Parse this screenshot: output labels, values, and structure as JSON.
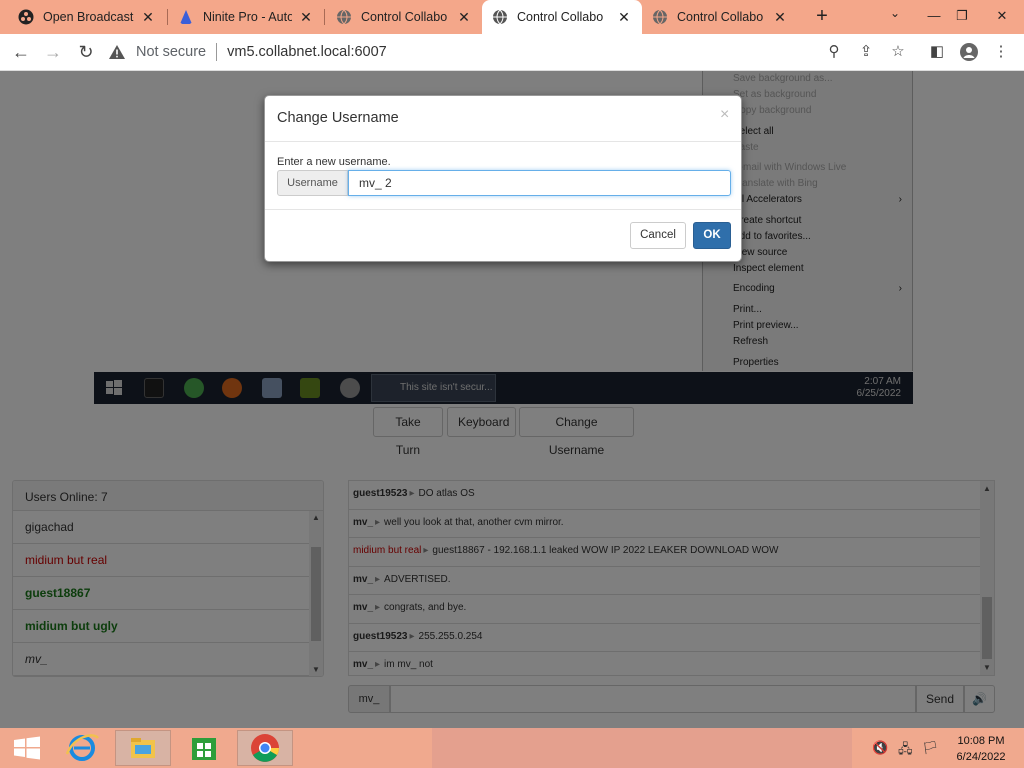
{
  "browser": {
    "tabs": [
      {
        "title": "Open Broadcaste",
        "icon": "obs-icon",
        "active": false
      },
      {
        "title": "Ninite Pro - Auto",
        "icon": "ninite-icon",
        "active": false
      },
      {
        "title": "Control Collabo",
        "icon": "globe-icon",
        "active": false
      },
      {
        "title": "Control Collabo",
        "icon": "globe-icon",
        "active": true
      },
      {
        "title": "Control Collabo",
        "icon": "globe-icon",
        "active": false
      }
    ],
    "security_label": "Not secure",
    "url": "vm5.collabnet.local:6007",
    "tabstrip_color": "#f4a78a"
  },
  "vm": {
    "context_menu": [
      {
        "label": "Save background as...",
        "dim": true
      },
      {
        "label": "Set as background",
        "dim": true
      },
      {
        "label": "Copy background",
        "dim": true
      },
      {
        "label": "Select all",
        "dim": false
      },
      {
        "label": "Paste",
        "dim": true
      },
      {
        "label": "E-mail with Windows Live",
        "dim": true
      },
      {
        "label": "Translate with Bing",
        "dim": true
      },
      {
        "label": "All Accelerators",
        "dim": false,
        "submenu": true
      },
      {
        "label": "Create shortcut",
        "dim": false
      },
      {
        "label": "Add to favorites...",
        "dim": false
      },
      {
        "label": "View source",
        "dim": false
      },
      {
        "label": "Inspect element",
        "dim": false
      },
      {
        "label": "Encoding",
        "dim": false,
        "submenu": true
      },
      {
        "label": "Print...",
        "dim": false
      },
      {
        "label": "Print preview...",
        "dim": false
      },
      {
        "label": "Refresh",
        "dim": false
      },
      {
        "label": "Properties",
        "dim": false
      }
    ],
    "taskbar_window": "This site isn't secur...",
    "clock_time": "2:07 AM",
    "clock_date": "6/25/2022"
  },
  "controls": {
    "take_turn": "Take Turn",
    "keyboard": "Keyboard",
    "change_username": "Change Username"
  },
  "users": {
    "header": "Users Online: 7",
    "list": [
      {
        "name": "gigachad",
        "style": "plain"
      },
      {
        "name": "midium but real",
        "style": "red"
      },
      {
        "name": "guest18867",
        "style": "green"
      },
      {
        "name": "midium but ugly",
        "style": "green"
      },
      {
        "name": "mv_",
        "style": "italic"
      }
    ]
  },
  "chat": {
    "messages": [
      {
        "user": "guest19523",
        "text": "DO atlas OS",
        "red": false
      },
      {
        "user": "mv_",
        "text": "well you look at that, another cvm mirror.",
        "red": false
      },
      {
        "user": "midium but real",
        "text": "guest18867 - 192.168.1.1 leaked WOW IP 2022 LEAKER DOWNLOAD WOW",
        "red": true
      },
      {
        "user": "mv_",
        "text": "ADVERTISED.",
        "red": false
      },
      {
        "user": "mv_",
        "text": "congrats, and bye.",
        "red": false
      },
      {
        "user": "guest19523",
        "text": "255.255.0.254",
        "red": false
      },
      {
        "user": "mv_",
        "text": "im mv_ not",
        "red": false
      }
    ],
    "input_username": "mv_",
    "send_label": "Send",
    "separator": "▸"
  },
  "modal": {
    "title": "Change Username",
    "close": "×",
    "prompt": "Enter a new username.",
    "addon_label": "Username",
    "input_value": "mv_ 2",
    "cancel_label": "Cancel",
    "ok_label": "OK",
    "ok_color": "#2f6fab"
  },
  "windows": {
    "clock_time": "10:08 PM",
    "clock_date": "6/24/2022",
    "taskbar_color": "#f0a98e"
  }
}
